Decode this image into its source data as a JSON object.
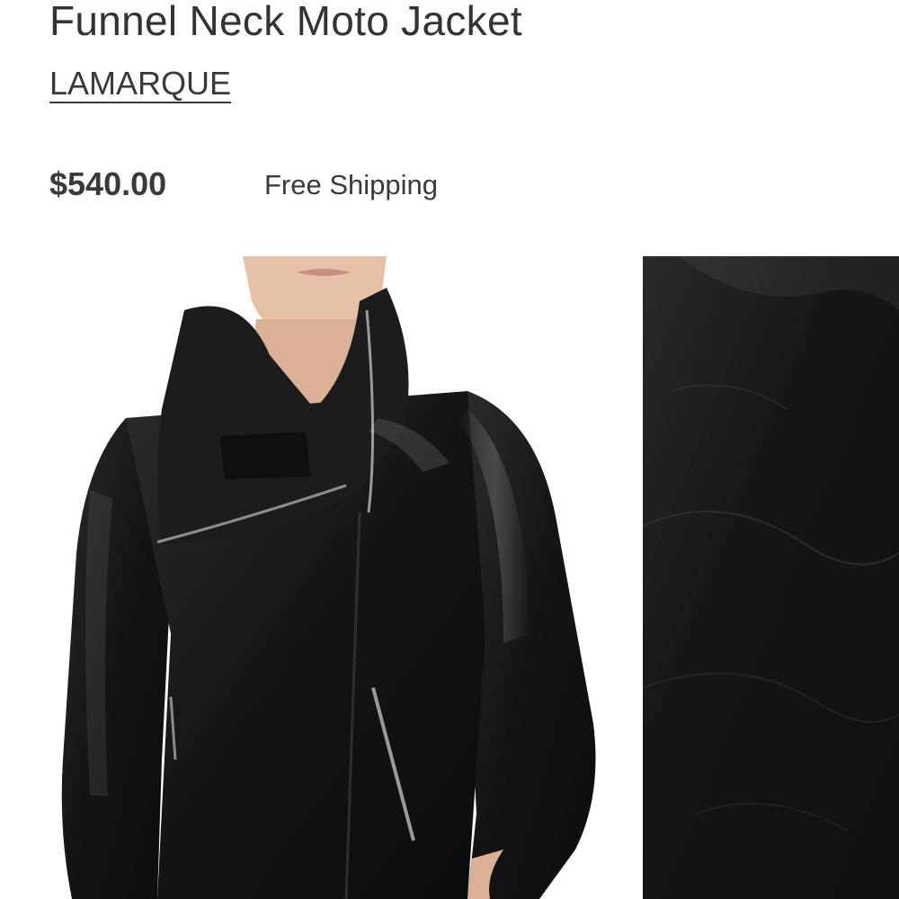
{
  "product": {
    "title": "Funnel Neck Moto Jacket",
    "brand": "LAMARQUE",
    "price": "$540.00",
    "shipping": "Free Shipping"
  },
  "images": {
    "main": {
      "icon": "product-photo-jacket-front"
    },
    "thumbnail": {
      "icon": "product-photo-leather-detail"
    }
  },
  "colors": {
    "text": "#333333",
    "leather": "#1a1a1a",
    "skin": "#e8c2a8",
    "background": "#ffffff"
  }
}
